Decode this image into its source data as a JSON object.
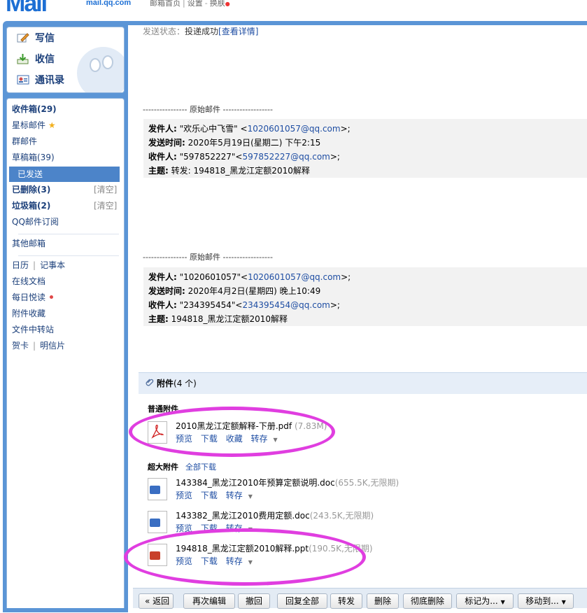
{
  "header": {
    "logo_url": "mail.qq.com",
    "link_home": "邮箱首页",
    "link_settings": "设置",
    "link_skin": "换肤"
  },
  "sidebar": {
    "compose": "写信",
    "receive": "收信",
    "contacts": "通讯录",
    "items": {
      "inbox": "收件箱(29)",
      "starred": "星标邮件",
      "group": "群邮件",
      "drafts": "草稿箱(39)",
      "sent": "已发送",
      "deleted": "已删除(3)",
      "spam": "垃圾箱(2)",
      "clear": "[清空]",
      "subscription": "QQ邮件订阅",
      "other": "其他邮箱",
      "calendar": "日历",
      "notes": "记事本",
      "docs": "在线文档",
      "daily": "每日悦读",
      "att_collection": "附件收藏",
      "transfer": "文件中转站",
      "cards": "贺卡",
      "postcards": "明信片"
    }
  },
  "mail": {
    "status_label": "发送状态：",
    "status_value": "投递成功",
    "status_link": "[查看详情]",
    "orig_label": "---------------- 原始邮件 ------------------",
    "quote1": {
      "from_label": "发件人:",
      "from_name": "\"欢乐心中飞雪\" <",
      "from_email": "1020601057@qq.com",
      "from_tail": ">;",
      "time_label": "发送时间:",
      "time": "2020年5月19日(星期二) 下午2:15",
      "to_label": "收件人:",
      "to_name": "\"597852227\"<",
      "to_email": "597852227@qq.com",
      "to_tail": ">;",
      "subject_label": "主题:",
      "subject": "转发: 194818_黑龙江定额2010解释"
    },
    "quote2": {
      "from_label": "发件人:",
      "from_name": "\"1020601057\"<",
      "from_email": "1020601057@qq.com",
      "from_tail": ">;",
      "time_label": "发送时间:",
      "time": "2020年4月2日(星期四) 晚上10:49",
      "to_label": "收件人:",
      "to_name": "\"234395454\"<",
      "to_email": "234395454@qq.com",
      "to_tail": ">;",
      "subject_label": "主题:",
      "subject": "194818_黑龙江定额2010解释"
    }
  },
  "attachments": {
    "title": "附件",
    "count": "(4 个)",
    "normal_title": "普通附件",
    "large_title": "超大附件",
    "download_all": "全部下载",
    "normal": [
      {
        "name": "2010黑龙江定额解释-下册.pdf",
        "size": "(7.83M)",
        "type": "pdf",
        "actions": [
          "预览",
          "下载",
          "收藏",
          "转存"
        ]
      }
    ],
    "large": [
      {
        "name": "143384_黑龙江2010年预算定额说明.doc",
        "size": "(655.5K,无限期)",
        "type": "doc",
        "actions": [
          "预览",
          "下载",
          "转存"
        ]
      },
      {
        "name": "143382_黑龙江2010费用定额.doc",
        "size": "(243.5K,无限期)",
        "type": "doc",
        "actions": [
          "预览",
          "下载",
          "转存"
        ]
      },
      {
        "name": "194818_黑龙江定额2010解释.ppt",
        "size": "(190.5K,无限期)",
        "type": "ppt",
        "actions": [
          "预览",
          "下载",
          "转存"
        ]
      }
    ]
  },
  "toolbar": {
    "back": "« 返回",
    "reedit": "再次编辑",
    "recall": "撤回",
    "reply_all": "回复全部",
    "forward": "转发",
    "delete": "删除",
    "perm_delete": "彻底删除",
    "mark_as": "标记为...",
    "move_to": "移动到..."
  },
  "colors": {
    "brand_blue": "#5b95d6",
    "selected_nav": "#4c84c9",
    "highlight_magenta": "#e03ee0",
    "link": "#1f4ea3"
  }
}
